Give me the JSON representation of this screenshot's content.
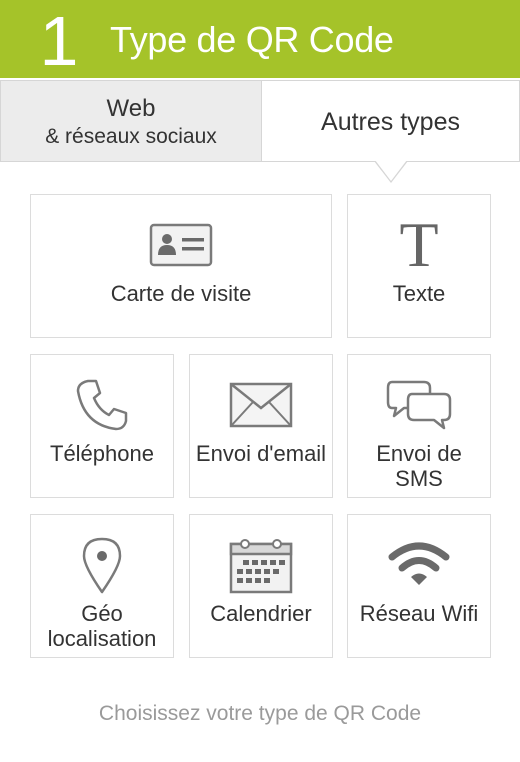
{
  "header": {
    "step": "1",
    "title": "Type de QR Code",
    "color": "#a5c329"
  },
  "tabs": {
    "web_line1": "Web",
    "web_line2": "& réseaux sociaux",
    "other": "Autres types"
  },
  "tiles": {
    "business_card": {
      "label": "Carte de visite",
      "icon": "contact-card-icon"
    },
    "text": {
      "label": "Texte",
      "icon": "text-t-icon",
      "glyph": "T"
    },
    "phone": {
      "label": "Téléphone",
      "icon": "phone-icon"
    },
    "email": {
      "label": "Envoi d'email",
      "icon": "envelope-icon"
    },
    "sms": {
      "label": "Envoi de SMS",
      "icon": "chat-bubbles-icon"
    },
    "geo": {
      "label": "Géo localisation",
      "icon": "map-pin-icon"
    },
    "calendar": {
      "label": "Calendrier",
      "icon": "calendar-icon"
    },
    "wifi": {
      "label": "Réseau Wifi",
      "icon": "wifi-icon"
    }
  },
  "footer": {
    "hint": "Choisissez votre type de QR Code"
  }
}
